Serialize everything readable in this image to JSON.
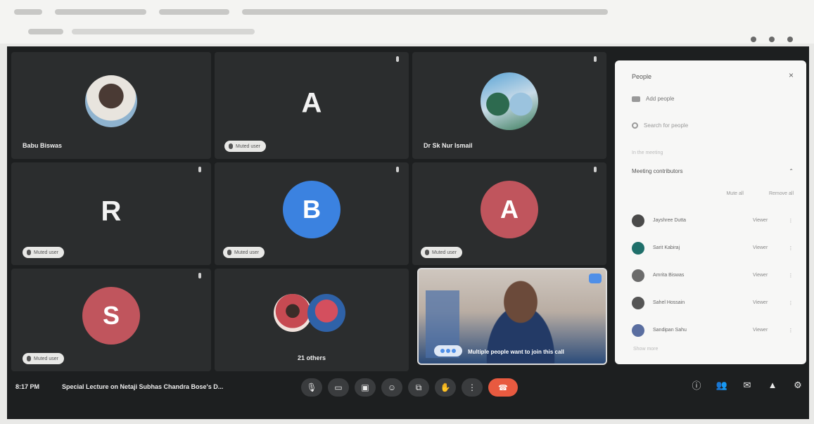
{
  "browser": {
    "chrome_color": "#f4f4f2"
  },
  "tiles": [
    {
      "kind": "photo",
      "name": "Babu Biswas"
    },
    {
      "kind": "letter",
      "letter": "A",
      "chip": "Muted user"
    },
    {
      "kind": "group-photo",
      "name": "Dr Sk Nur Ismail"
    },
    {
      "kind": "letter",
      "letter": "R",
      "chip": "Muted user"
    },
    {
      "kind": "avatar",
      "letter": "B",
      "color": "#3b82e0",
      "chip": "Muted user"
    },
    {
      "kind": "avatar",
      "letter": "A",
      "color": "#c0555d",
      "chip": "Muted user"
    },
    {
      "kind": "avatar",
      "letter": "S",
      "color": "#c0555d",
      "chip": "Muted user"
    },
    {
      "kind": "pair",
      "name": "21 others"
    }
  ],
  "self_view": {
    "message": "Multiple people want to join this call"
  },
  "people_panel": {
    "title": "People",
    "close": "×",
    "add_people": "Add people",
    "search_placeholder": "Search for people",
    "section": "In the meeting",
    "meeting_row": "Meeting contributors",
    "mute_all": "Mute all",
    "remove_all": "Remove all",
    "participants": [
      {
        "name": "Jayshree Dutta",
        "role": "Viewer",
        "color": "#4a4a4a"
      },
      {
        "name": "Sarit Kabiraj",
        "role": "Viewer",
        "color": "#1f6f6a"
      },
      {
        "name": "Amrita Biswas",
        "role": "Viewer",
        "color": "#6b6b6b"
      },
      {
        "name": "Sahel Hossain",
        "role": "Viewer",
        "color": "#555555"
      },
      {
        "name": "Sandipan Sahu",
        "role": "Viewer",
        "color": "#5a6ea0"
      }
    ],
    "more": "Show more"
  },
  "bottom_bar": {
    "time": "8:17 PM",
    "title": "Special Lecture on Netaji Subhas Chandra Bose's D...",
    "controls": [
      "mic-icon",
      "camera-icon",
      "captions-icon",
      "emoji-icon",
      "present-icon",
      "raise-hand-icon",
      "more-icon",
      "end-call-icon"
    ],
    "end_call_color": "#e85a40",
    "right_controls": [
      "info-icon",
      "people-icon",
      "chat-icon",
      "activities-icon",
      "host-controls-icon"
    ]
  }
}
